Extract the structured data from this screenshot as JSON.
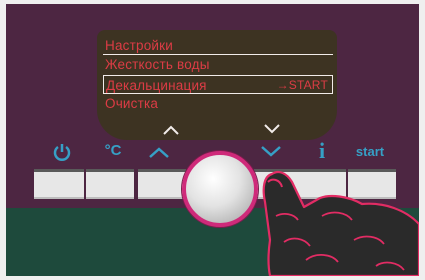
{
  "display": {
    "menu": [
      {
        "label": "Настройки"
      },
      {
        "label": "Жесткость воды"
      },
      {
        "label": "Декальцинация",
        "action": "→START"
      },
      {
        "label": "Очистка"
      }
    ]
  },
  "buttons": {
    "temp_label": "°C",
    "info_label": "i",
    "start_label": "start"
  },
  "icons": {
    "power": "power-icon",
    "up": "chevron-up-icon",
    "down": "chevron-down-icon",
    "info": "info-icon"
  },
  "colors": {
    "panel": "#4d2642",
    "display_text": "#dc3c45",
    "button_labels": "#36a0c6",
    "knob_ring": "#cf2a7a"
  }
}
